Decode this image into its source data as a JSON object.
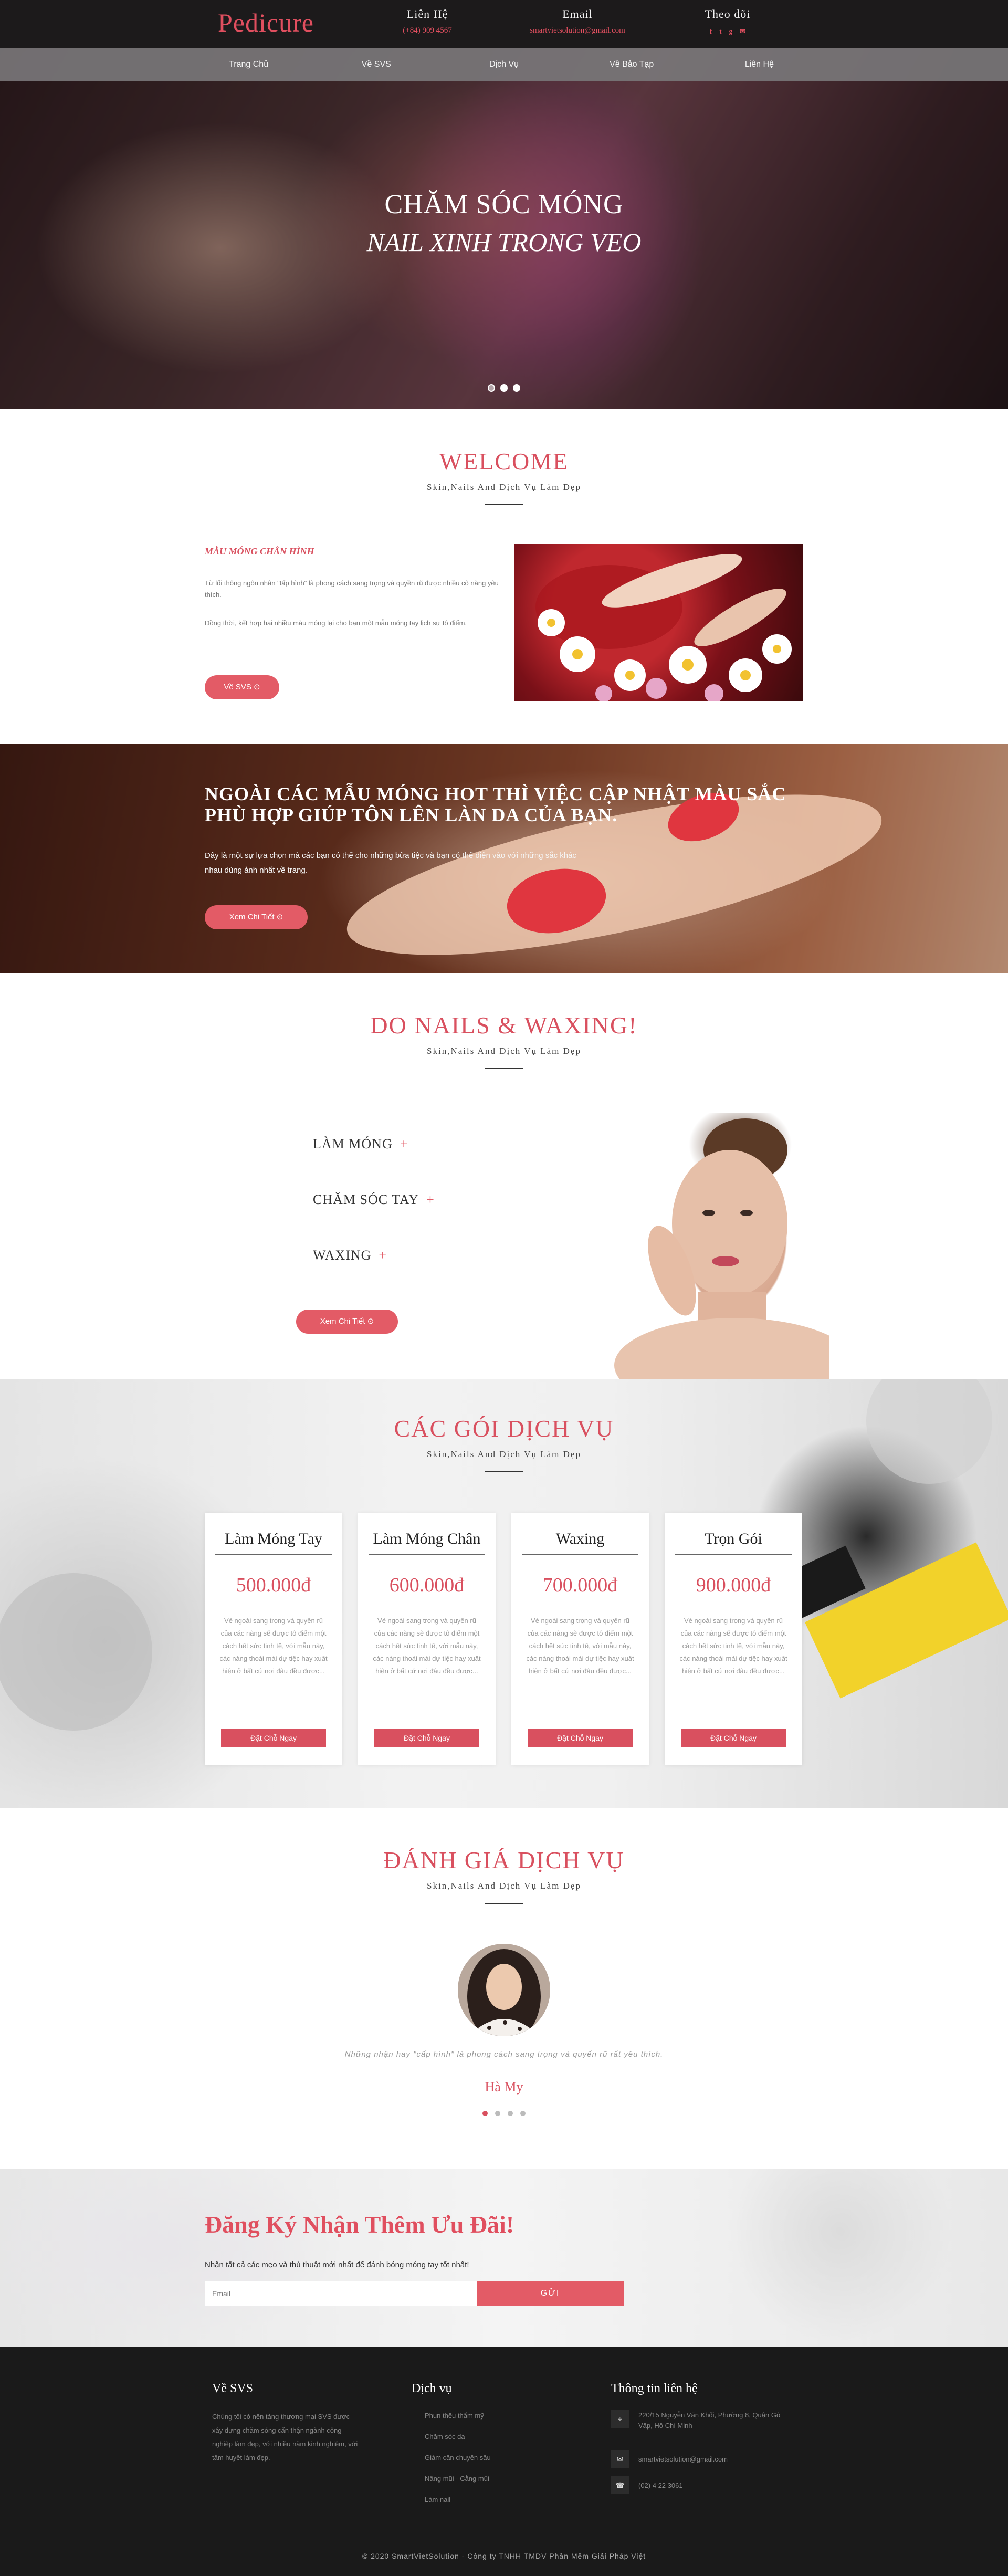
{
  "header": {
    "logo": "Pedicure",
    "contact_title": "Liên Hệ",
    "contact_value": "(+84) 909 4567",
    "email_title": "Email",
    "email_value": "smartvietsolution@gmail.com",
    "follow_title": "Theo dõi",
    "social": [
      "f",
      "t",
      "g",
      "✉"
    ]
  },
  "nav": [
    "Trang Chủ",
    "Về SVS",
    "Dịch Vụ",
    "Về Bảo Tạp",
    "Liên Hệ"
  ],
  "hero": {
    "line1": "CHĂM SÓC MÓNG",
    "line2": "NAIL XINH TRONG VEO",
    "dots": 3,
    "active_dot": 2
  },
  "welcome": {
    "title": "WELCOME",
    "subtitle": "Skin,Nails And Dịch Vụ Làm Đẹp",
    "heading": "MẪU MÓNG CHÂN HÌNH",
    "para1": "Từ lối thông ngôn nhân \"tấp hình\" là phong cách sang trọng và quyền rũ được nhiều cô nàng yêu thích.",
    "para2": "Đồng thời, kết hợp hai nhiều màu móng lại cho bạn một mẫu móng tay lịch sự tô điểm.",
    "button": "Về SVS ⊙"
  },
  "banner": {
    "title": "NGOÀI CÁC MẪU MÓNG HOT THÌ VIỆC CẬP NHẬT MÀU SẮC PHÙ HỢP GIÚP TÔN LÊN LÀN DA CỦA BẠN.",
    "text": "Đây là một sự lựa chọn mà các bạn có thể cho những bữa tiệc và bạn có thể diện vào với những sắc khác nhau dùng ảnh nhất về trang.",
    "button": "Xem Chi Tiết ⊙"
  },
  "nails": {
    "title": "DO NAILS & WAXING!",
    "subtitle": "Skin,Nails And Dịch Vụ Làm Đẹp",
    "items": [
      "LÀM MÓNG",
      "CHĂM SÓC TAY",
      "WAXING"
    ],
    "plus": "+",
    "button": "Xem Chi Tiết ⊙"
  },
  "packages": {
    "title": "CÁC GÓI DỊCH VỤ",
    "subtitle": "Skin,Nails And Dịch Vụ Làm Đẹp",
    "cards": [
      {
        "name": "Làm Móng Tay",
        "price": "500.000đ",
        "desc": "Vẻ ngoài sang trọng và quyến rũ của các nàng sẽ được tô điểm một cách hết sức tinh tế, với mẫu này, các nàng thoải mái dự tiệc hay xuất hiện ở bất cứ nơi đâu đều được...",
        "button": "Đặt Chỗ Ngay"
      },
      {
        "name": "Làm Móng Chân",
        "price": "600.000đ",
        "desc": "Vẻ ngoài sang trọng và quyến rũ của các nàng sẽ được tô điểm một cách hết sức tinh tế, với mẫu này, các nàng thoải mái dự tiệc hay xuất hiện ở bất cứ nơi đâu đều được...",
        "button": "Đặt Chỗ Ngay"
      },
      {
        "name": "Waxing",
        "price": "700.000đ",
        "desc": "Vẻ ngoài sang trọng và quyến rũ của các nàng sẽ được tô điểm một cách hết sức tinh tế, với mẫu này, các nàng thoải mái dự tiệc hay xuất hiện ở bất cứ nơi đâu đều được...",
        "button": "Đặt Chỗ Ngay"
      },
      {
        "name": "Trọn Gói",
        "price": "900.000đ",
        "desc": "Vẻ ngoài sang trọng và quyến rũ của các nàng sẽ được tô điểm một cách hết sức tinh tế, với mẫu này, các nàng thoải mái dự tiệc hay xuất hiện ở bất cứ nơi đâu đều được...",
        "button": "Đặt Chỗ Ngay"
      }
    ]
  },
  "reviews": {
    "title": "ĐÁNH GIÁ DỊCH VỤ",
    "subtitle": "Skin,Nails And Dịch Vụ Làm Đẹp",
    "quote": "Những nhận hay \"cấp hình\" là phong cách sang trọng và quyến rũ rất yêu thích.",
    "name": "Hà My",
    "dots": 4,
    "active_dot": 0
  },
  "newsletter": {
    "title": "Đăng Ký Nhận Thêm Ưu Đãi!",
    "text": "Nhận tất cả các mẹo và thủ thuật mới nhất để đánh bóng móng tay tốt nhất!",
    "placeholder": "Email",
    "button": "GỬI"
  },
  "footer": {
    "about_title": "Về SVS",
    "about_text": "Chúng tôi có nền tảng thương mại SVS được xây dựng chăm sóng cẩn thận ngành công nghiệp làm đẹp, với nhiều năm kinh nghiệm, với tâm huyết làm đẹp.",
    "services_title": "Dịch vụ",
    "services": [
      "Phun thêu thẩm mỹ",
      "Chăm sóc da",
      "Giảm cân chuyên sâu",
      "Nâng mũi - Cằng mũi",
      "Làm nail"
    ],
    "contact_title": "Thông tin liên hệ",
    "address": "220/15 Nguyễn Văn Khối, Phường 8, Quận Gò Vấp, Hồ Chí Minh",
    "email": "smartvietsolution@gmail.com",
    "phone": "(02) 4 22 3061",
    "copyright": "© 2020 SmartVietSolution - Công ty TNHH TMDV Phần Mềm Giải Pháp Việt"
  },
  "colors": {
    "accent": "#e04f5f",
    "dark": "#1c1a1b",
    "footer": "#1a1a1a"
  }
}
